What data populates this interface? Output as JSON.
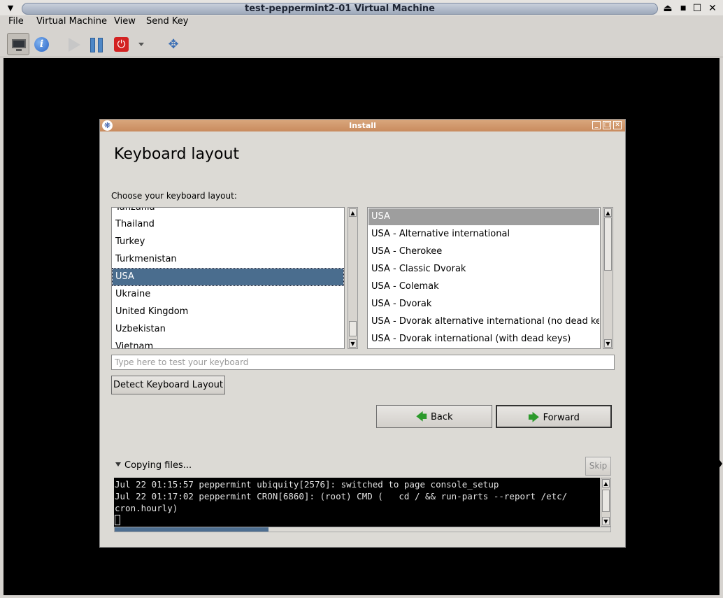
{
  "window": {
    "title": "test-peppermint2-01 Virtual Machine"
  },
  "menubar": {
    "items": [
      "File",
      "Virtual Machine",
      "View",
      "Send Key"
    ]
  },
  "install": {
    "title": "Install",
    "heading": "Keyboard layout",
    "choose_label": "Choose your keyboard layout:",
    "left_list": [
      "Tanzania",
      "Thailand",
      "Turkey",
      "Turkmenistan",
      "USA",
      "Ukraine",
      "United Kingdom",
      "Uzbekistan",
      "Vietnam"
    ],
    "left_selected": "USA",
    "right_list": [
      "USA",
      "USA - Alternative international",
      "USA - Cherokee",
      "USA - Classic Dvorak",
      "USA - Colemak",
      "USA - Dvorak",
      "USA - Dvorak alternative international (no dead keys)",
      "USA - Dvorak international (with dead keys)"
    ],
    "right_selected": "USA",
    "test_placeholder": "Type here to test your keyboard",
    "detect_button": "Detect Keyboard Layout",
    "back_button": "Back",
    "forward_button": "Forward",
    "copying_label": "Copying files...",
    "skip_button": "Skip",
    "log_lines": [
      "Jul 22 01:15:57 peppermint ubiquity[2576]: switched to page console_setup",
      "Jul 22 01:17:02 peppermint CRON[6860]: (root) CMD (   cd / && run-parts --report /etc/",
      "cron.hourly)"
    ],
    "progress": 0.31
  }
}
